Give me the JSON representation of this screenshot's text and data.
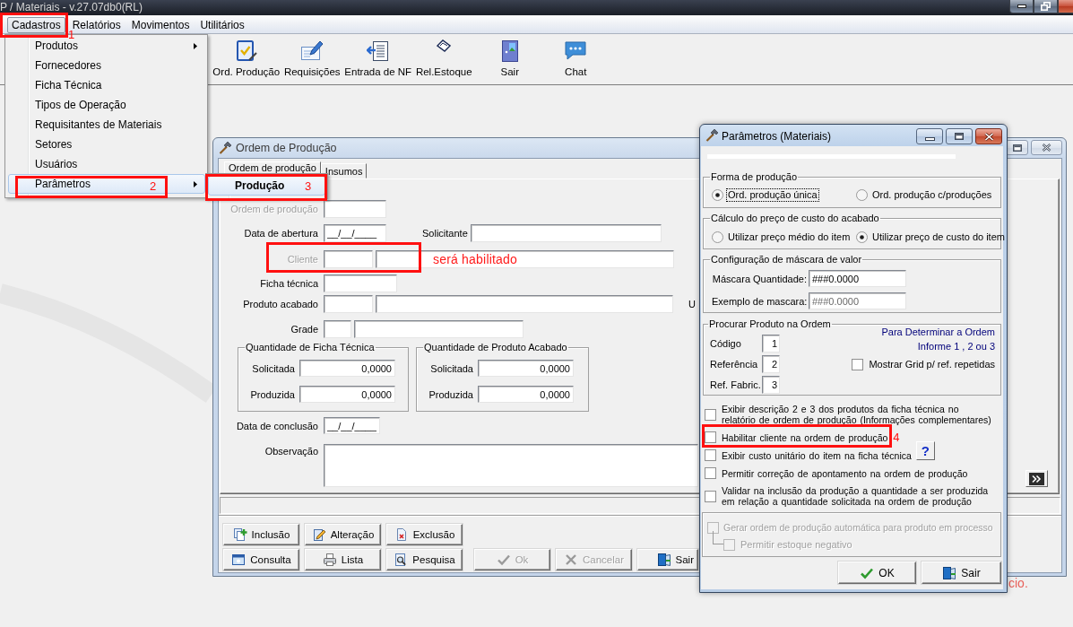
{
  "app_window": {
    "title": "P / Materiais - v.27.07db0(RL)"
  },
  "menu_bar": [
    {
      "label": "Cadastros",
      "selected": true,
      "annotation": "1"
    },
    {
      "label": "Relatórios",
      "selected": false
    },
    {
      "label": "Movimentos",
      "selected": false
    },
    {
      "label": "Utilitários",
      "selected": false
    }
  ],
  "toolbar": [
    {
      "label": "Ord. Produção"
    },
    {
      "label": "Requisições"
    },
    {
      "label": "Entrada de NF"
    },
    {
      "label": "Rel.Estoque"
    },
    {
      "label": "Sair"
    },
    {
      "label": "Chat"
    }
  ],
  "cadastros_menu": [
    {
      "label": "Produtos",
      "submenu": true,
      "selected": false
    },
    {
      "label": "Fornecedores",
      "submenu": false,
      "selected": false
    },
    {
      "label": "Ficha Técnica",
      "submenu": false,
      "selected": false
    },
    {
      "label": "Tipos de Operação",
      "submenu": false,
      "selected": false
    },
    {
      "label": "Requisitantes de Materiais",
      "submenu": false,
      "selected": false
    },
    {
      "label": "Setores",
      "submenu": false,
      "selected": false
    },
    {
      "label": "Usuários",
      "submenu": false,
      "selected": false
    },
    {
      "label": "Parâmetros",
      "submenu": true,
      "selected": true,
      "annotation": "2"
    }
  ],
  "parametros_submenu": [
    {
      "label": "Produção",
      "selected": true,
      "annotation": "3"
    }
  ],
  "desktop_text": "cio.",
  "ordem_window": {
    "title": "Ordem de Produção",
    "tabs": [
      {
        "label": "Ordem de produção",
        "selected": true
      },
      {
        "label": "Insumos",
        "selected": false
      }
    ],
    "rows": [
      {
        "label": "Ordem de produção",
        "disabled": true
      },
      {
        "label": "Data de abertura",
        "disabled": false,
        "value": "__/__/____",
        "side_label": "Solicitante"
      },
      {
        "label": "Cliente",
        "disabled": true,
        "annotation": "será habilitado"
      },
      {
        "label": "Ficha técnica",
        "disabled": false
      },
      {
        "label": "Produto acabado",
        "disabled": false,
        "side_label": "U"
      },
      {
        "label": "Grade",
        "disabled": false
      }
    ],
    "quantity_groups": [
      {
        "title": "Quantidade de Ficha Técnica",
        "rows": [
          {
            "label": "Solicitada",
            "value": "0,0000"
          },
          {
            "label": "Produzida",
            "value": "0,0000"
          }
        ]
      },
      {
        "title": "Quantidade de Produto Acabado",
        "rows": [
          {
            "label": "Solicitada",
            "value": "0,0000"
          },
          {
            "label": "Produzida",
            "value": "0,0000"
          }
        ]
      }
    ],
    "data_conclusao": {
      "label": "Data de conclusão",
      "value": "__/__/____"
    },
    "observacao": {
      "label": "Observação"
    },
    "buttons": [
      {
        "label": "Inclusão",
        "disabled": false
      },
      {
        "label": "Alteração",
        "disabled": false
      },
      {
        "label": "Exclusão",
        "disabled": false
      },
      {
        "label": "Consulta",
        "disabled": false
      },
      {
        "label": "Lista",
        "disabled": false
      },
      {
        "label": "Pesquisa",
        "disabled": false
      },
      {
        "label": "Ok",
        "disabled": true
      },
      {
        "label": "Cancelar",
        "disabled": true
      },
      {
        "label": "Sair",
        "disabled": false
      }
    ]
  },
  "parametros_dialog": {
    "title": "Parâmetros (Materiais)",
    "forma_de_producao": {
      "title": "Forma de produção",
      "options": [
        {
          "label": "Ord. produção única",
          "selected": true,
          "focused": true
        },
        {
          "label": "Ord. produção c/produções",
          "selected": false,
          "focused": false
        }
      ]
    },
    "calculo_preco_custo": {
      "title": "Cálculo do preço de custo do acabado",
      "options": [
        {
          "label": "Utilizar preço médio do item",
          "selected": false,
          "focused": false
        },
        {
          "label": "Utilizar preço de custo do item",
          "selected": true,
          "focused": false
        }
      ]
    },
    "mascara_valor": {
      "title": "Configuração de máscara de valor",
      "fields": [
        {
          "label": "Máscara Quantidade:",
          "value": "###0.0000",
          "disabled": false
        },
        {
          "label": "Exemplo de mascara:",
          "value": "###0.0000",
          "disabled": true
        }
      ]
    },
    "procurar_produto": {
      "title": "Procurar Produto na Ordem",
      "fields": [
        {
          "label": "Código",
          "value": "1"
        },
        {
          "label": "Referência",
          "value": "2"
        },
        {
          "label": "Ref. Fabric.",
          "value": "3"
        }
      ],
      "hint_lines": [
        "Para Determinar a Ordem",
        "Informe 1 , 2 ou 3"
      ],
      "grid_option": {
        "label": "Mostrar Grid p/ ref. repetidas",
        "checked": false
      }
    },
    "options": [
      {
        "label": "Exibir descrição 2 e 3 dos produtos da ficha técnica no relatório de ordem de produção (Informações complementares)",
        "checked": false
      },
      {
        "label": "Habilitar cliente na ordem de produção",
        "checked": false,
        "annotation": "4"
      },
      {
        "label": "Exibir custo unitário do item na ficha técnica",
        "checked": false,
        "help_button": "?"
      },
      {
        "label": "Permitir correção de apontamento na ordem de produção",
        "checked": false
      },
      {
        "label": "Validar na inclusão da produção a quantidade a ser produzida em relação a quantidade solicitada na ordem de produção",
        "checked": false
      }
    ],
    "automatic_group": {
      "option": {
        "label": "Gerar ordem de produção automática para produto em processo",
        "checked": false,
        "disabled": true
      },
      "sub_option": {
        "label": "Permitir estoque negativo",
        "checked": false,
        "disabled": true
      }
    },
    "buttons": [
      {
        "label": "OK"
      },
      {
        "label": "Sair"
      }
    ]
  }
}
